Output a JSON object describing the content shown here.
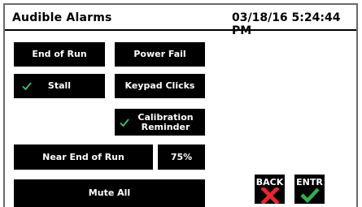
{
  "header": {
    "title": "Audible Alarms",
    "datetime": "03/18/16 5:24:44 PM"
  },
  "buttons": {
    "end_of_run": {
      "label": "End of Run",
      "checked": false
    },
    "power_fail": {
      "label": "Power Fail",
      "checked": false
    },
    "stall": {
      "label": "Stall",
      "checked": true
    },
    "keypad_clicks": {
      "label": "Keypad Clicks",
      "checked": false
    },
    "calibration_reminder": {
      "label_line1": "Calibration",
      "label_line2": "Reminder",
      "checked": true
    },
    "near_end_of_run": {
      "label": "Near End of Run",
      "percent": "75%"
    },
    "mute_all": {
      "label": "Mute All"
    }
  },
  "nav": {
    "back_label": "BACK",
    "enter_label": "ENTR"
  },
  "colors": {
    "button_bg": "#000000",
    "check_green": "#3fbf6a",
    "back_red": "#e8262b",
    "enter_green": "#2fb04a"
  }
}
